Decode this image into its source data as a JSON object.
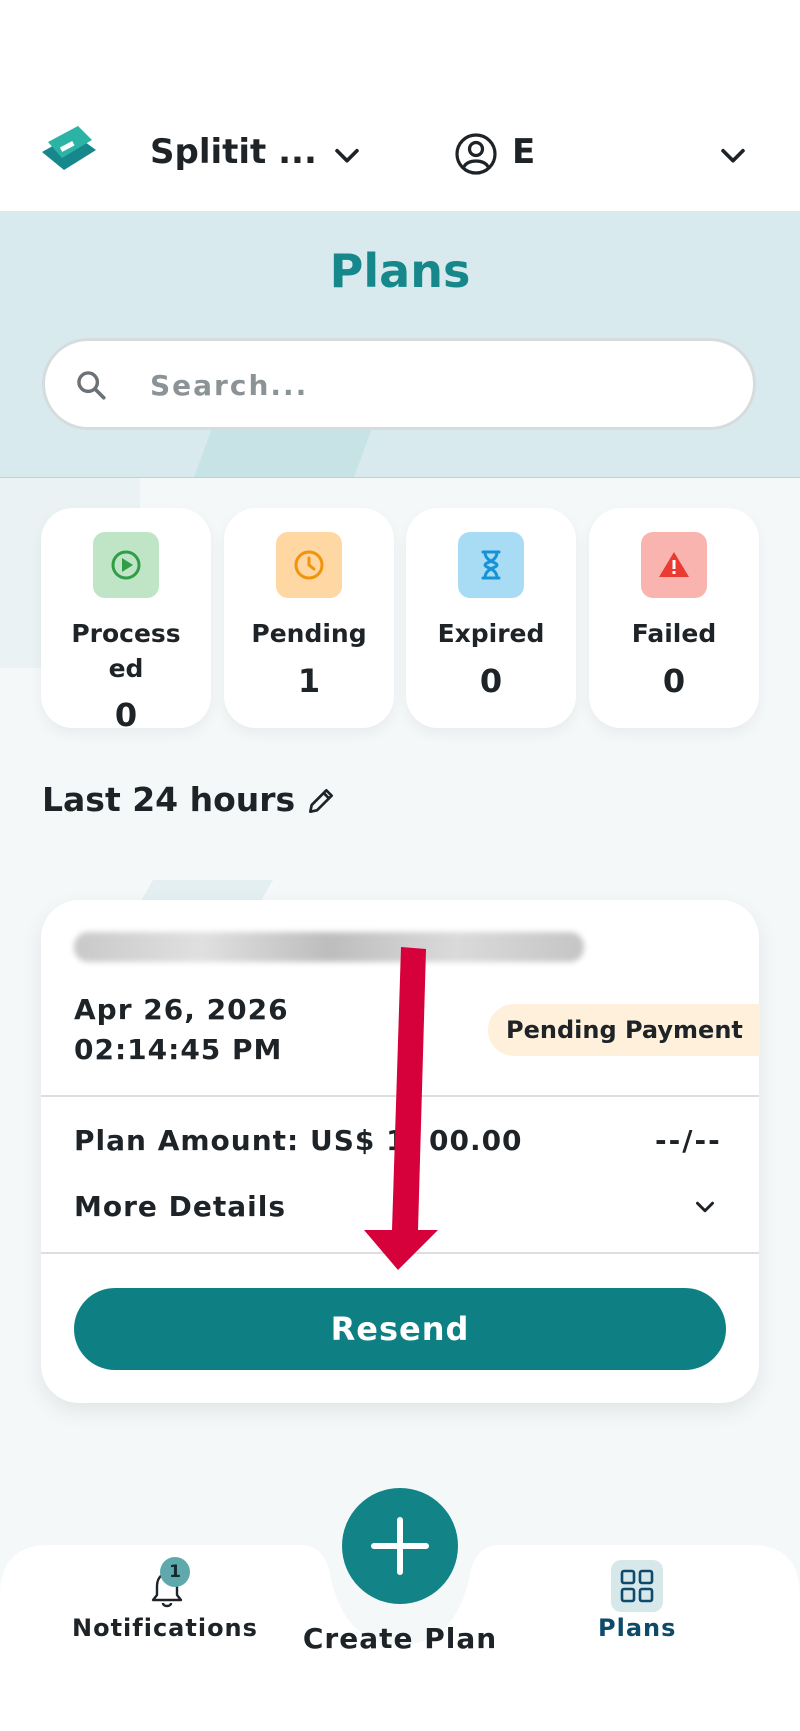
{
  "header": {
    "company_name": "Splitit ...",
    "user_initial": "E"
  },
  "hero": {
    "title": "Plans",
    "search_placeholder": "Search..."
  },
  "status_cards": [
    {
      "label": "Process\ned",
      "count": "0",
      "icon": "play-circle-icon",
      "bg": "#bfe5c6",
      "fg": "#2f9e46"
    },
    {
      "label": "Pending",
      "count": "1",
      "icon": "clock-icon",
      "bg": "#ffd7a3",
      "fg": "#f0940c"
    },
    {
      "label": "Expired",
      "count": "0",
      "icon": "hourglass-icon",
      "bg": "#a8dcf5",
      "fg": "#1593d6"
    },
    {
      "label": "Failed",
      "count": "0",
      "icon": "warning-icon",
      "bg": "#f9b4b0",
      "fg": "#ea3b32"
    }
  ],
  "period": {
    "label": "Last 24 hours"
  },
  "plan": {
    "date": "Apr 26, 2026",
    "time": "02:14:45 PM",
    "status": "Pending Payment",
    "amount": "Plan Amount: US$ 1,  00.00",
    "installments": "--/--",
    "more_details": "More Details",
    "resend_label": "Resend"
  },
  "nav": {
    "notifications_label": "Notifications",
    "notifications_count": "1",
    "create_label": "Create Plan",
    "plans_label": "Plans"
  },
  "colors": {
    "teal": "#0e8084",
    "hero_bg": "#d8eaed",
    "annotation_arrow": "#d6003a"
  }
}
